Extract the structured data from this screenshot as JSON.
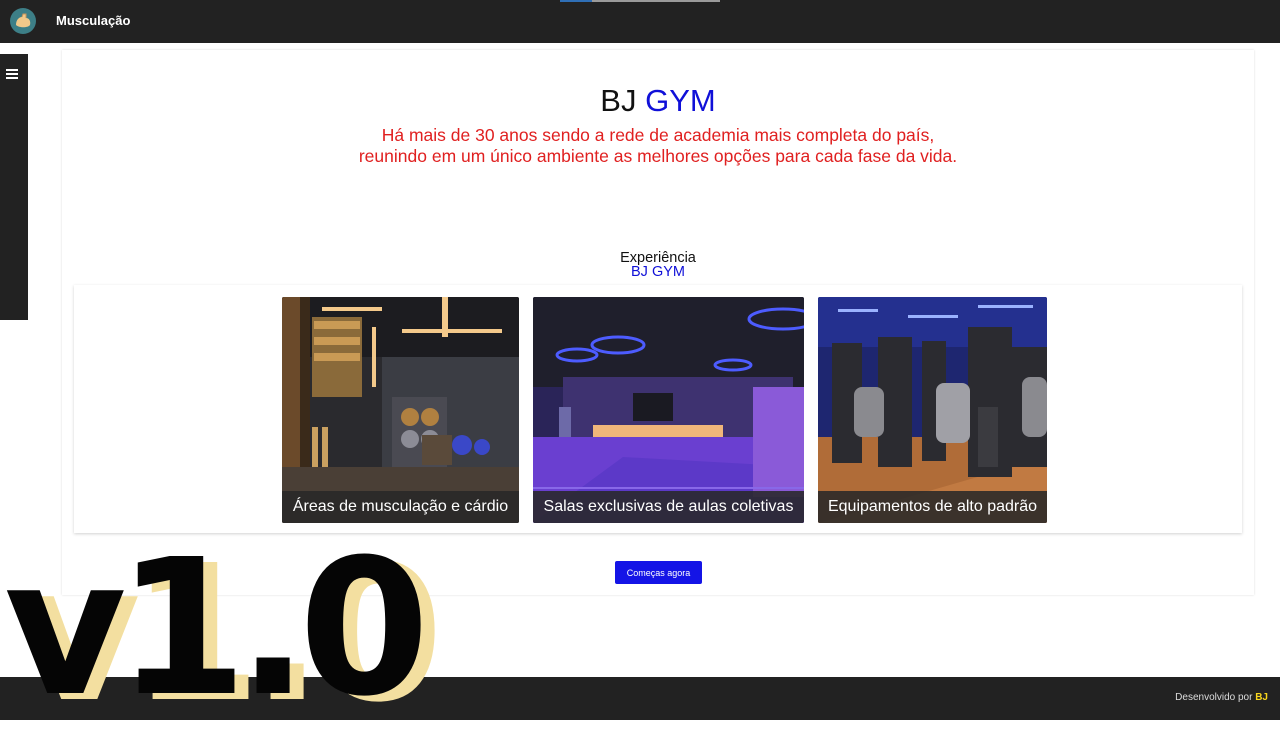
{
  "header": {
    "app_title": "Musculação"
  },
  "sidebar": {
    "menu_icon": "hamburger-menu-icon"
  },
  "hero": {
    "title_main": "BJ",
    "title_accent": "GYM",
    "subtitle_line1": "Há mais de 30 anos sendo a rede de academia mais completa do país,",
    "subtitle_line2": "reunindo em um único ambiente as melhores opções para cada fase da vida."
  },
  "experience": {
    "title": "Experiência",
    "brand": "BJ GYM",
    "cards": [
      {
        "caption": "Áreas de musculação e cárdio"
      },
      {
        "caption": "Salas exclusivas de aulas coletivas"
      },
      {
        "caption": "Equipamentos de alto padrão"
      }
    ]
  },
  "cta": {
    "label": "Começas agora"
  },
  "footer": {
    "prefix": "Desenvolvido por",
    "brand": "BJ"
  },
  "overlay": {
    "version": "v1.0"
  },
  "colors": {
    "topbar": "#222222",
    "accent_blue": "#1010d8",
    "subtitle_red": "#e02020",
    "button_blue": "#1414e6",
    "footer_brand": "#f7d51d"
  }
}
